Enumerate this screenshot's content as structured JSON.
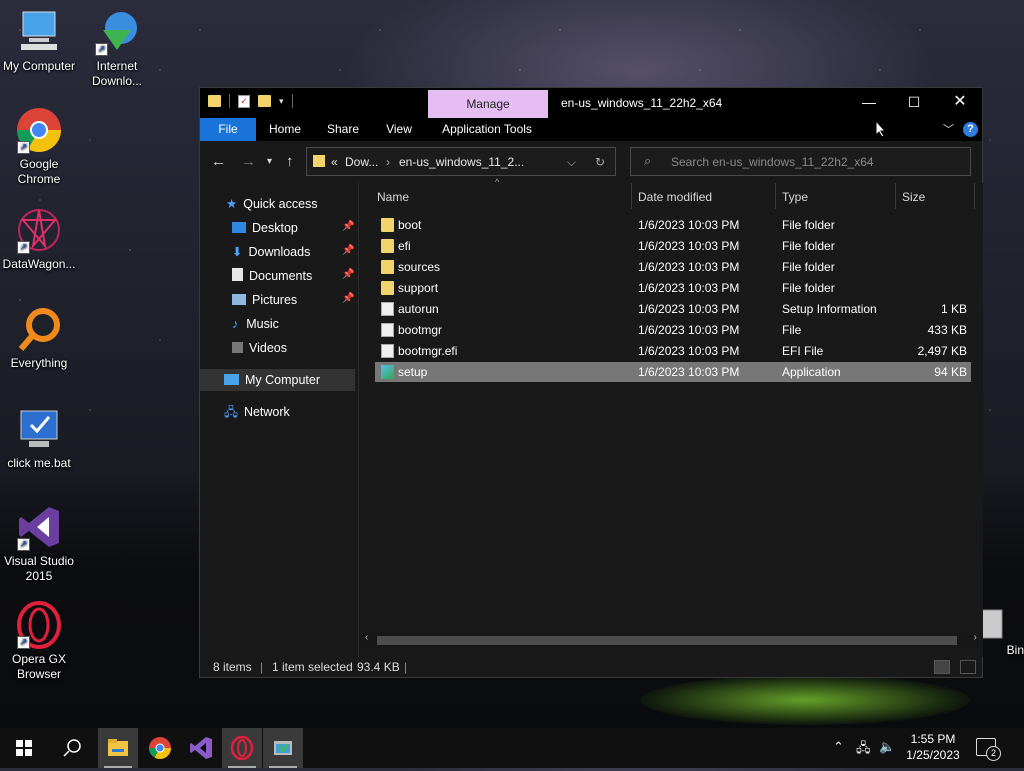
{
  "desktop": {
    "icons": [
      {
        "label": "My Computer"
      },
      {
        "label": "Internet\nDownlo..."
      },
      {
        "label": "Google\nChrome"
      },
      {
        "label": "DataWagon..."
      },
      {
        "label": "Everything"
      },
      {
        "label": "click me.bat"
      },
      {
        "label": "Visual Studio\n2015"
      },
      {
        "label": "Opera GX\nBrowser"
      },
      {
        "label": "Bin"
      }
    ]
  },
  "window": {
    "title": "en-us_windows_11_22h2_x64",
    "manage_label": "Manage",
    "ribbon_tabs": [
      "File",
      "Home",
      "Share",
      "View",
      "Application Tools"
    ],
    "address": {
      "prefix": "«",
      "crumb1": "Dow...",
      "crumb2": "en-us_windows_11_2..."
    },
    "search_placeholder": "Search en-us_windows_11_22h2_x64",
    "nav": {
      "quick_access": "Quick access",
      "items": [
        "Desktop",
        "Downloads",
        "Documents",
        "Pictures",
        "Music",
        "Videos"
      ],
      "my_computer": "My Computer",
      "network": "Network"
    },
    "columns": [
      "Name",
      "Date modified",
      "Type",
      "Size"
    ],
    "files": [
      {
        "name": "boot",
        "date": "1/6/2023 10:03 PM",
        "type": "File folder",
        "size": "",
        "icon": "folder-icon"
      },
      {
        "name": "efi",
        "date": "1/6/2023 10:03 PM",
        "type": "File folder",
        "size": "",
        "icon": "folder-icon"
      },
      {
        "name": "sources",
        "date": "1/6/2023 10:03 PM",
        "type": "File folder",
        "size": "",
        "icon": "folder-icon"
      },
      {
        "name": "support",
        "date": "1/6/2023 10:03 PM",
        "type": "File folder",
        "size": "",
        "icon": "folder-icon"
      },
      {
        "name": "autorun",
        "date": "1/6/2023 10:03 PM",
        "type": "Setup Information",
        "size": "1 KB",
        "icon": "settings-file-icon"
      },
      {
        "name": "bootmgr",
        "date": "1/6/2023 10:03 PM",
        "type": "File",
        "size": "433 KB",
        "icon": "file-icon"
      },
      {
        "name": "bootmgr.efi",
        "date": "1/6/2023 10:03 PM",
        "type": "EFI File",
        "size": "2,497 KB",
        "icon": "file-icon"
      },
      {
        "name": "setup",
        "date": "1/6/2023 10:03 PM",
        "type": "Application",
        "size": "94 KB",
        "icon": "setup-app-icon",
        "selected": true
      }
    ],
    "status": {
      "items": "8 items",
      "sep": "|",
      "selected": "1 item selected",
      "size": "93.4 KB",
      "sep2": "|"
    }
  },
  "taskbar": {
    "time": "1:55 PM",
    "date": "1/25/2023",
    "notifications": "2"
  },
  "colors": {
    "file_tab": "#1a73d9",
    "manage_tab": "#e6bdf2",
    "selected_row": "#777777",
    "folder": "#f3d36b"
  }
}
